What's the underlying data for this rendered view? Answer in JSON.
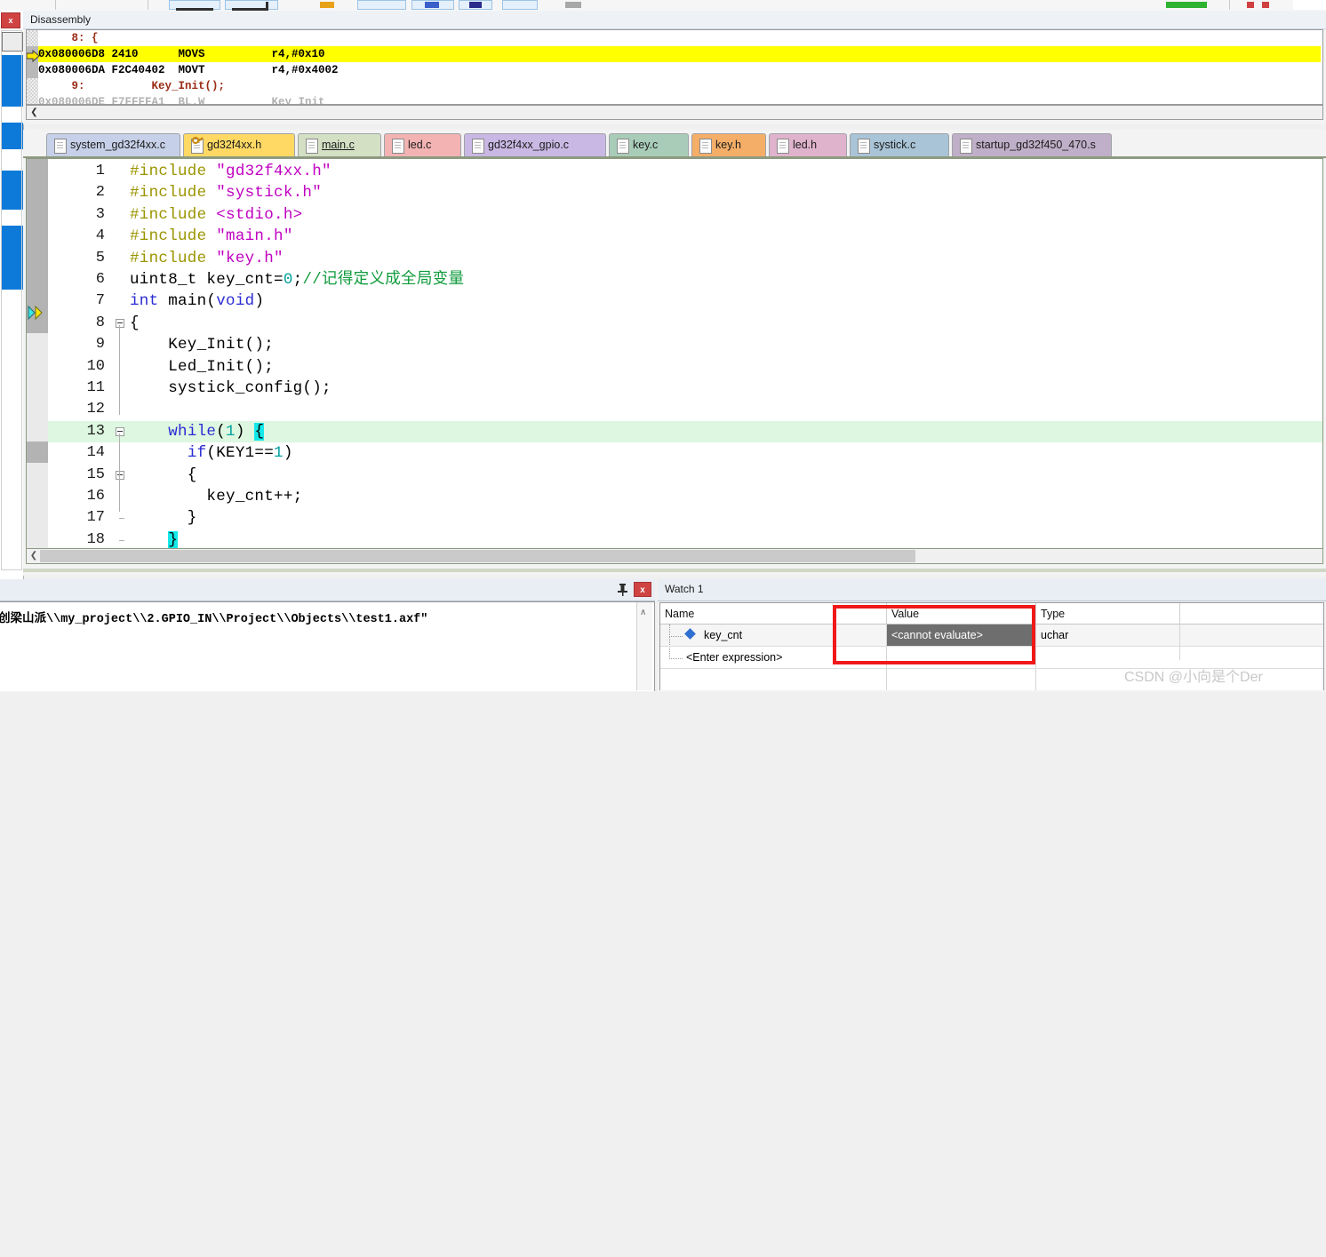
{
  "window": {
    "app": "Keil uVision Debug Session"
  },
  "toolbar": {
    "icons": [
      "undo-icon",
      "redo-icon",
      "bookmark-icon",
      "breakpoint-icon",
      "insert-breakpoint-icon",
      "kill-breakpoints-icon",
      "step-icon",
      "run-icon",
      "reset-icon"
    ]
  },
  "left_rail": {
    "close_label": "x",
    "selection_count": 4
  },
  "disassembly": {
    "title": "Disassembly",
    "rows": [
      {
        "kind": "src",
        "text": "     8: {",
        "current": false
      },
      {
        "kind": "asm",
        "text": "0x080006D8 2410      MOVS          r4,#0x10",
        "current": true
      },
      {
        "kind": "asm",
        "text": "0x080006DA F2C40402  MOVT          r4,#0x4002",
        "current": false
      },
      {
        "kind": "src",
        "text": "     9:          Key_Init();",
        "current": false
      }
    ],
    "hscroll_left_arrow": "❮"
  },
  "tabs": [
    {
      "label": "system_gd32f4xx.c",
      "color": "#c6d0e8",
      "active": false,
      "icon": "file-icon"
    },
    {
      "label": "gd32f4xx.h",
      "color": "#ffd964",
      "active": false,
      "icon": "file-key-icon"
    },
    {
      "label": "main.c",
      "color": "#d4e0c4",
      "active": true,
      "icon": "file-icon"
    },
    {
      "label": "led.c",
      "color": "#f3b3b3",
      "active": false,
      "icon": "file-icon"
    },
    {
      "label": "gd32f4xx_gpio.c",
      "color": "#c9b8e4",
      "active": false,
      "icon": "file-icon"
    },
    {
      "label": "key.c",
      "color": "#a9ccb9",
      "active": false,
      "icon": "file-icon"
    },
    {
      "label": "key.h",
      "color": "#f4ae68",
      "active": false,
      "icon": "file-icon"
    },
    {
      "label": "led.h",
      "color": "#e0b3cd",
      "active": false,
      "icon": "file-icon"
    },
    {
      "label": "systick.c",
      "color": "#a9c4d6",
      "active": false,
      "icon": "file-icon"
    },
    {
      "label": "startup_gd32f450_470.s",
      "color": "#c0afc8",
      "active": false,
      "icon": "file-icon"
    }
  ],
  "editor": {
    "filename": "main.c",
    "current_line": 13,
    "execution_marker_line": 8,
    "lines": [
      {
        "n": 1,
        "tokens": [
          {
            "t": "#include ",
            "c": "pre"
          },
          {
            "t": "\"gd32f4xx.h\"",
            "c": "str"
          }
        ]
      },
      {
        "n": 2,
        "tokens": [
          {
            "t": "#include ",
            "c": "pre"
          },
          {
            "t": "\"systick.h\"",
            "c": "str"
          }
        ]
      },
      {
        "n": 3,
        "tokens": [
          {
            "t": "#include ",
            "c": "pre"
          },
          {
            "t": "<stdio.h>",
            "c": "str"
          }
        ]
      },
      {
        "n": 4,
        "tokens": [
          {
            "t": "#include ",
            "c": "pre"
          },
          {
            "t": "\"main.h\"",
            "c": "str"
          }
        ]
      },
      {
        "n": 5,
        "tokens": [
          {
            "t": "#include ",
            "c": "pre"
          },
          {
            "t": "\"key.h\"",
            "c": "str"
          }
        ]
      },
      {
        "n": 6,
        "tokens": [
          {
            "t": "uint8_t key_cnt=",
            "c": "pl"
          },
          {
            "t": "0",
            "c": "num"
          },
          {
            "t": ";",
            "c": "pl"
          },
          {
            "t": "//记得定义成全局变量",
            "c": "cmt"
          }
        ]
      },
      {
        "n": 7,
        "tokens": [
          {
            "t": "int ",
            "c": "kw"
          },
          {
            "t": "main(",
            "c": "pl"
          },
          {
            "t": "void",
            "c": "kw"
          },
          {
            "t": ")",
            "c": "pl"
          }
        ]
      },
      {
        "n": 8,
        "tokens": [
          {
            "t": "{",
            "c": "pl"
          }
        ],
        "fold": true
      },
      {
        "n": 9,
        "tokens": [
          {
            "t": "    Key_Init();",
            "c": "pl"
          }
        ]
      },
      {
        "n": 10,
        "tokens": [
          {
            "t": "    Led_Init();",
            "c": "pl"
          }
        ]
      },
      {
        "n": 11,
        "tokens": [
          {
            "t": "    systick_config();",
            "c": "pl"
          }
        ]
      },
      {
        "n": 12,
        "tokens": [
          {
            "t": "",
            "c": "pl"
          }
        ]
      },
      {
        "n": 13,
        "tokens": [
          {
            "t": "    ",
            "c": "pl"
          },
          {
            "t": "while",
            "c": "kw"
          },
          {
            "t": "(",
            "c": "pl"
          },
          {
            "t": "1",
            "c": "num"
          },
          {
            "t": ") ",
            "c": "pl"
          },
          {
            "t": "{",
            "c": "brace"
          }
        ],
        "fold": true,
        "highlight": true
      },
      {
        "n": 14,
        "tokens": [
          {
            "t": "      ",
            "c": "pl"
          },
          {
            "t": "if",
            "c": "kw"
          },
          {
            "t": "(KEY1==",
            "c": "pl"
          },
          {
            "t": "1",
            "c": "num"
          },
          {
            "t": ")",
            "c": "pl"
          }
        ]
      },
      {
        "n": 15,
        "tokens": [
          {
            "t": "      {",
            "c": "pl"
          }
        ],
        "fold": true
      },
      {
        "n": 16,
        "tokens": [
          {
            "t": "        key_cnt++;",
            "c": "pl"
          }
        ]
      },
      {
        "n": 17,
        "tokens": [
          {
            "t": "      }",
            "c": "pl"
          }
        ]
      },
      {
        "n": 18,
        "tokens": [
          {
            "t": "    ",
            "c": "pl"
          },
          {
            "t": "}",
            "c": "brace"
          }
        ]
      }
    ],
    "hscroll_left_arrow": "❮"
  },
  "command_pane": {
    "pin_icon": "pin-icon",
    "close_label": "x",
    "output": "创梁山派\\\\my_project\\\\2.GPIO_IN\\\\Project\\\\Objects\\\\test1.axf\"",
    "scroll_up_arrow": "∧"
  },
  "watch": {
    "title": "Watch 1",
    "columns": [
      "Name",
      "Value",
      "Type"
    ],
    "rows": [
      {
        "name": "key_cnt",
        "value": "<cannot evaluate>",
        "type": "uchar",
        "has_marker": true
      },
      {
        "name": "<Enter expression>",
        "value": "",
        "type": "",
        "has_marker": false
      }
    ],
    "annotation_color": "#f01818"
  },
  "watermark": {
    "text": "CSDN @小向是个Der"
  }
}
